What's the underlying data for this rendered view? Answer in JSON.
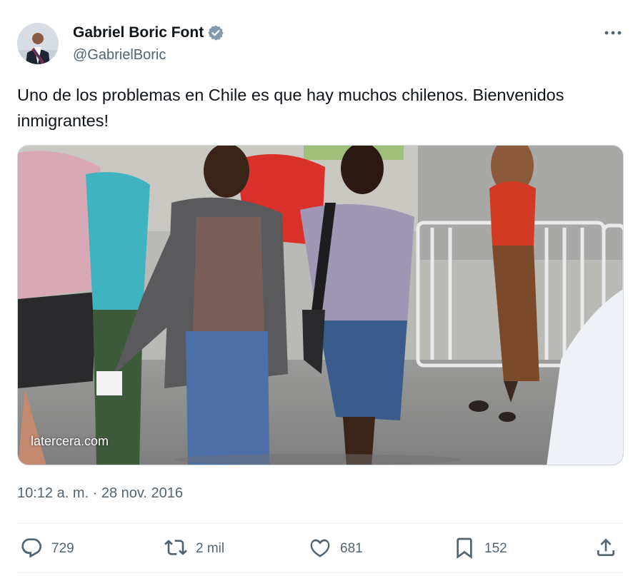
{
  "author": {
    "display_name": "Gabriel Boric Font",
    "handle": "@GabrielBoric",
    "verified_icon": "verified-badge-icon",
    "verified_color": "#829aab"
  },
  "tweet": {
    "text": "Uno de los problemas en Chile es que hay muchos chilenos. Bienvenidos inmigrantes!",
    "media_watermark": "latercera.com",
    "timestamp": "10:12 a. m. · 28 nov. 2016"
  },
  "actions": {
    "replies": "729",
    "reposts": "2 mil",
    "likes": "681",
    "bookmarks": "152"
  },
  "colors": {
    "text_primary": "#0f1419",
    "text_secondary": "#536471",
    "divider": "#eff3f4"
  }
}
